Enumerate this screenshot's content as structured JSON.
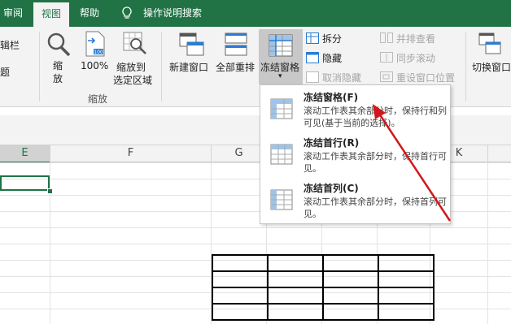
{
  "tabs": [
    {
      "label": "审阅",
      "active": false
    },
    {
      "label": "视图",
      "active": true
    },
    {
      "label": "帮助",
      "active": false
    }
  ],
  "tell_me": {
    "label": "操作说明搜索",
    "icon": "lightbulb-icon"
  },
  "ribbon": {
    "partial_labels": [
      "辑栏",
      "题"
    ],
    "zoom_button": "缩放",
    "zoom100_button": "100%",
    "zoom_selection_line1": "缩放到",
    "zoom_selection_line2": "选定区域",
    "zoom_group_label": "缩放",
    "new_window": "新建窗口",
    "arrange_all": "全部重排",
    "freeze_panes": "冻结窗格",
    "split": "拆分",
    "hide": "隐藏",
    "unhide": "取消隐藏",
    "side_by_side": "并排查看",
    "sync_scroll": "同步滚动",
    "reset_position": "重设窗口位置",
    "switch_windows": "切换窗口"
  },
  "columns": [
    "E",
    "F",
    "G",
    "K"
  ],
  "freeze_menu": {
    "items": [
      {
        "title": "冻结窗格(F)",
        "desc": "滚动工作表其余部分时，保持行和列可见(基于当前的选择)。"
      },
      {
        "title": "冻结首行(R)",
        "desc": "滚动工作表其余部分时，保持首行可见。"
      },
      {
        "title": "冻结首列(C)",
        "desc": "滚动工作表其余部分时，保持首列可见。"
      }
    ]
  },
  "colors": {
    "accent": "#217346",
    "arrow": "#d0181b"
  }
}
